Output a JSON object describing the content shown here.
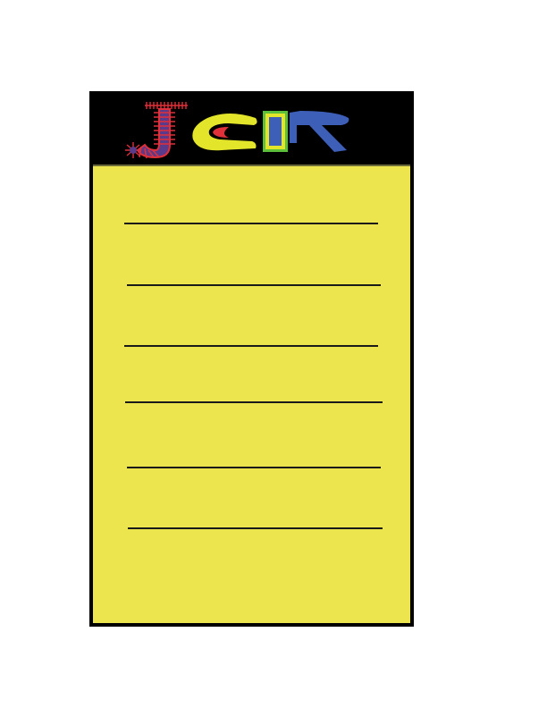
{
  "logo": {
    "letters": "JCPR",
    "icon": "jcpr-logo",
    "colors": {
      "j_fill": "#5a3a8a",
      "j_stitches": "#e0303a",
      "c_outer": "#e3e52a",
      "c_inner": "#e0303a",
      "p_outer": "#5cbf3a",
      "p_mid": "#e3e52a",
      "p_inner": "#3d5fb8",
      "r_fill": "#3d5fb8"
    }
  },
  "notepad": {
    "background": "#ece54e",
    "header_background": "#000000",
    "border_color": "#000000",
    "ruled_line_count": 6,
    "lines": [
      "",
      "",
      "",
      "",
      "",
      ""
    ]
  }
}
